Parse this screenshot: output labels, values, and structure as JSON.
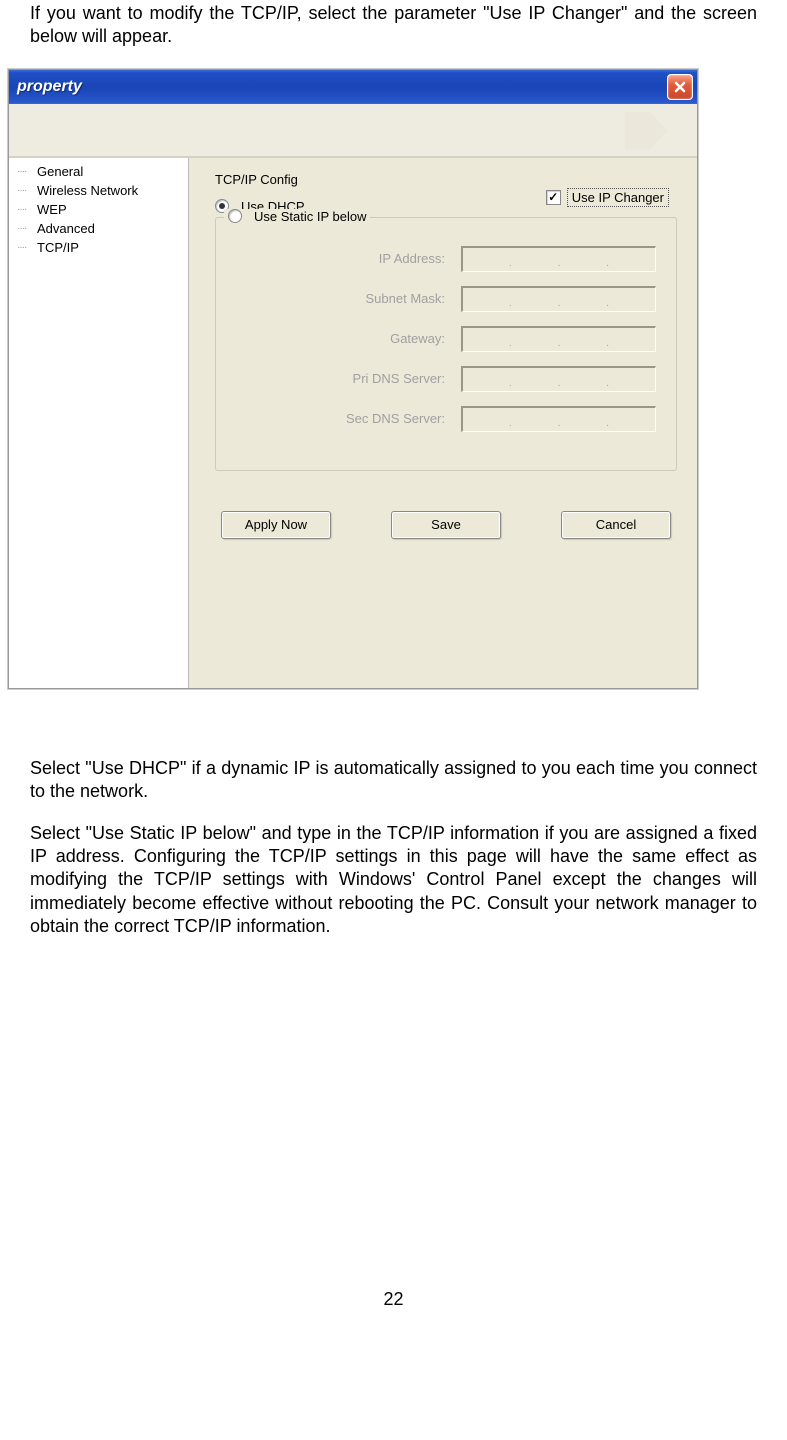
{
  "intro": "If you want to modify the TCP/IP, select the parameter \"Use IP Changer\" and the screen below will appear.",
  "window": {
    "title": "property",
    "sidebar": [
      "General",
      "Wireless Network",
      "WEP",
      "Advanced",
      "TCP/IP"
    ],
    "heading": "TCP/IP Config",
    "use_ip_changer": {
      "label": "Use IP Changer",
      "checked": "✓"
    },
    "radio_dhcp": "Use DHCP",
    "radio_static": "Use Static IP below",
    "fields": {
      "ip": "IP Address:",
      "subnet": "Subnet Mask:",
      "gateway": "Gateway:",
      "pri_dns": "Pri DNS Server:",
      "sec_dns": "Sec DNS Server:"
    },
    "buttons": {
      "apply": "Apply Now",
      "save": "Save",
      "cancel": "Cancel"
    }
  },
  "post1": "Select \"Use DHCP\" if a dynamic IP is automatically assigned to you each time you connect to the network.",
  "post2": "Select \"Use Static IP below\" and type in the TCP/IP information if you are assigned a fixed IP address. Configuring the TCP/IP settings in this page will have the same effect as modifying the TCP/IP settings with Windows' Control Panel except the changes will immediately become effective without rebooting the PC. Consult your network manager to obtain the correct TCP/IP information.",
  "page_number": "22"
}
